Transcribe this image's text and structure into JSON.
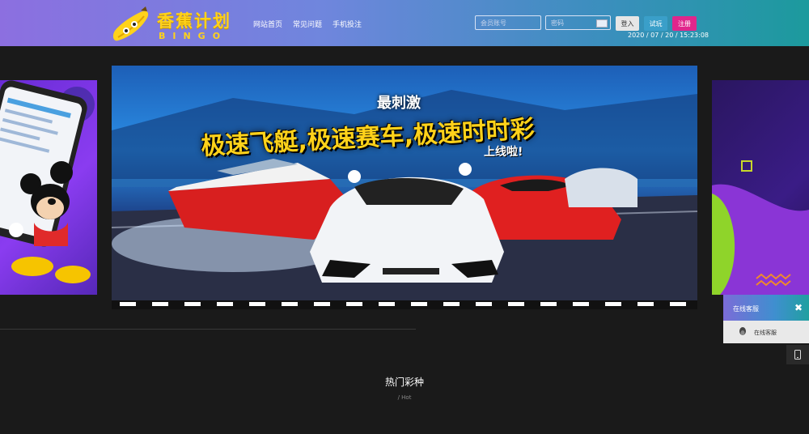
{
  "logo": {
    "title": "香蕉计划",
    "sub": "BINGO"
  },
  "nav": {
    "items": [
      "网站首页",
      "常见问题",
      "手机投注"
    ]
  },
  "login": {
    "account_placeholder": "会员账号",
    "password_placeholder": "密码",
    "login_label": "登入",
    "trial_label": "试玩",
    "register_label": "注册",
    "datetime": "2020 / 07 / 20 / 15:23:08"
  },
  "banner": {
    "tagline": "最刺激",
    "headline": "极速飞艇,极速赛车,极速时时彩",
    "online": "上线啦!"
  },
  "section": {
    "title": "热门彩种",
    "sub": "/ Hot"
  },
  "chat": {
    "title": "在线客服",
    "row_label": "在线客服"
  },
  "colors": {
    "header_start": "#8c6fe0",
    "header_end": "#1c9a9d",
    "register": "#e0268c",
    "trial": "#3a9fc9",
    "logo": "#ffd21a"
  }
}
